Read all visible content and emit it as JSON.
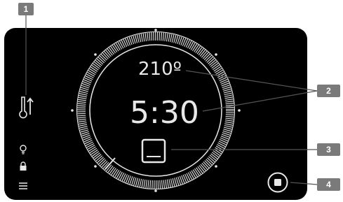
{
  "oven_display": {
    "temperature": "210º",
    "timer": "5:30",
    "icons": {
      "thermometer": "thermometer-up-icon",
      "bulb": "light-bulb-icon",
      "lock": "lock-icon",
      "menu": "menu-icon",
      "mode": "oven-mode-icon",
      "stop": "stop-icon"
    },
    "ring_progress": 0.9
  },
  "callouts": {
    "c1": "1",
    "c2": "2",
    "c3": "3",
    "c4": "4"
  },
  "colors": {
    "screen": "#000000",
    "foreground": "#e8e8e8",
    "callout": "#7a7a7a"
  }
}
